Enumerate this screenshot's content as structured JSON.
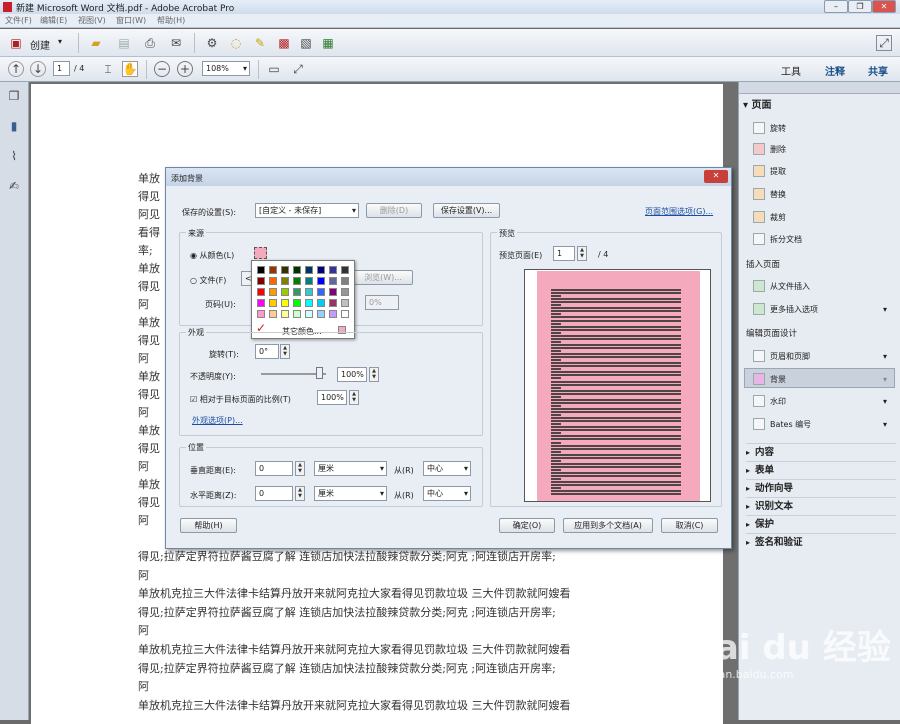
{
  "window": {
    "title": "新建 Microsoft Word 文档.pdf - Adobe Acrobat Pro"
  },
  "menu": [
    "文件(F)",
    "编辑(E)",
    "视图(V)",
    "窗口(W)",
    "帮助(H)"
  ],
  "toolbar": {
    "create_label": "创建",
    "page_current": "1",
    "page_total": "/ 4",
    "zoom": "108%",
    "tools": "工具",
    "comment": "注释",
    "share": "共享"
  },
  "doc_lines": [
    "单放",
    "得见",
    "阿见",
    "看得",
    "率;",
    "单放",
    "得见",
    "阿",
    "单放",
    "得见",
    "阿",
    "单放",
    "得见",
    "阿",
    "单放",
    "得见",
    "阿",
    "单放",
    "得见",
    "阿",
    "得见;拉萨定界符拉萨酱豆腐了解 连锁店加快法拉酸辣贷款分类;阿克 ;阿连锁店开房率;",
    "阿",
    "单放机克拉三大件法律卡结算丹放开来就阿克拉大家看得见罚款垃圾 三大件罚款就阿嫂看",
    "得见;拉萨定界符拉萨酱豆腐了解 连锁店加快法拉酸辣贷款分类;阿克 ;阿连锁店开房率;",
    "阿",
    "单放机克拉三大件法律卡结算丹放开来就阿克拉大家看得见罚款垃圾 三大件罚款就阿嫂看",
    "得见;拉萨定界符拉萨酱豆腐了解 连锁店加快法拉酸辣贷款分类;阿克 ;阿连锁店开房率;",
    "阿",
    "单放机克拉三大件法律卡结算丹放开来就阿克拉大家看得见罚款垃圾 三大件罚款就阿嫂看"
  ],
  "right_panel": {
    "page_section": "页面",
    "page_items": [
      "旋转",
      "删除",
      "提取",
      "替换",
      "裁剪",
      "拆分文档"
    ],
    "insert_section": "插入页面",
    "insert_items": [
      "从文件插入",
      "更多插入选项"
    ],
    "design_section": "编辑页面设计",
    "design_items": [
      "页眉和页脚",
      "背景",
      "水印",
      "Bates 编号"
    ],
    "collapsed": [
      "内容",
      "表单",
      "动作向导",
      "识别文本",
      "保护",
      "签名和验证"
    ]
  },
  "dialog": {
    "title": "添加背景",
    "saved_settings_label": "保存的设置(S):",
    "saved_settings_value": "[自定义 - 未保存]",
    "delete_btn": "删除(D)",
    "save_settings_btn": "保存设置(V)...",
    "page_range_link": "页面范围选项(G)...",
    "source_group": "来源",
    "from_color": "从颜色(L)",
    "file_label": "文件(F)",
    "file_value": "<",
    "browse_btn": "浏览(W)...",
    "page_num_label": "页码(U):",
    "scale_value": "0%",
    "more_colors": "其它颜色...",
    "appearance_group": "外观",
    "rotate_label": "旋转(T):",
    "rotate_value": "0°",
    "opacity_label": "不透明度(Y):",
    "opacity_value": "100%",
    "relative_label": "相对于目标页面的比例(T)",
    "relative_value": "100%",
    "appearance_link": "外观选项(P)...",
    "position_group": "位置",
    "vertical_label": "垂直距离(E):",
    "vertical_value": "0",
    "unit1": "厘米",
    "from1": "从(R)",
    "anchor1": "中心",
    "horizontal_label": "水平距离(Z):",
    "horizontal_value": "0",
    "unit2": "厘米",
    "from2": "从(R)",
    "anchor2": "中心",
    "preview_group": "预览",
    "preview_page_label": "预览页面(E)",
    "preview_page_value": "1",
    "preview_page_total": "/ 4",
    "help_btn": "帮助(H)",
    "ok_btn": "确定(O)",
    "apply_multi_btn": "应用到多个文档(A)",
    "cancel_btn": "取消(C)",
    "bg_color": "#f4a9bd"
  },
  "palette_colors": [
    [
      "#000000",
      "#993300",
      "#333300",
      "#003300",
      "#003366",
      "#000080",
      "#333399",
      "#333333"
    ],
    [
      "#800000",
      "#ff6600",
      "#808000",
      "#008000",
      "#008080",
      "#0000ff",
      "#666699",
      "#808080"
    ],
    [
      "#ff0000",
      "#ff9900",
      "#99cc00",
      "#339966",
      "#33cccc",
      "#3366ff",
      "#800080",
      "#969696"
    ],
    [
      "#ff00ff",
      "#ffcc00",
      "#ffff00",
      "#00ff00",
      "#00ffff",
      "#00ccff",
      "#993366",
      "#c0c0c0"
    ],
    [
      "#ff99cc",
      "#ffcc99",
      "#ffff99",
      "#ccffcc",
      "#ccffff",
      "#99ccff",
      "#cc99ff",
      "#ffffff"
    ]
  ],
  "watermark": {
    "brand": "Bai du 经验",
    "url": "jingyan.baidu.com"
  }
}
